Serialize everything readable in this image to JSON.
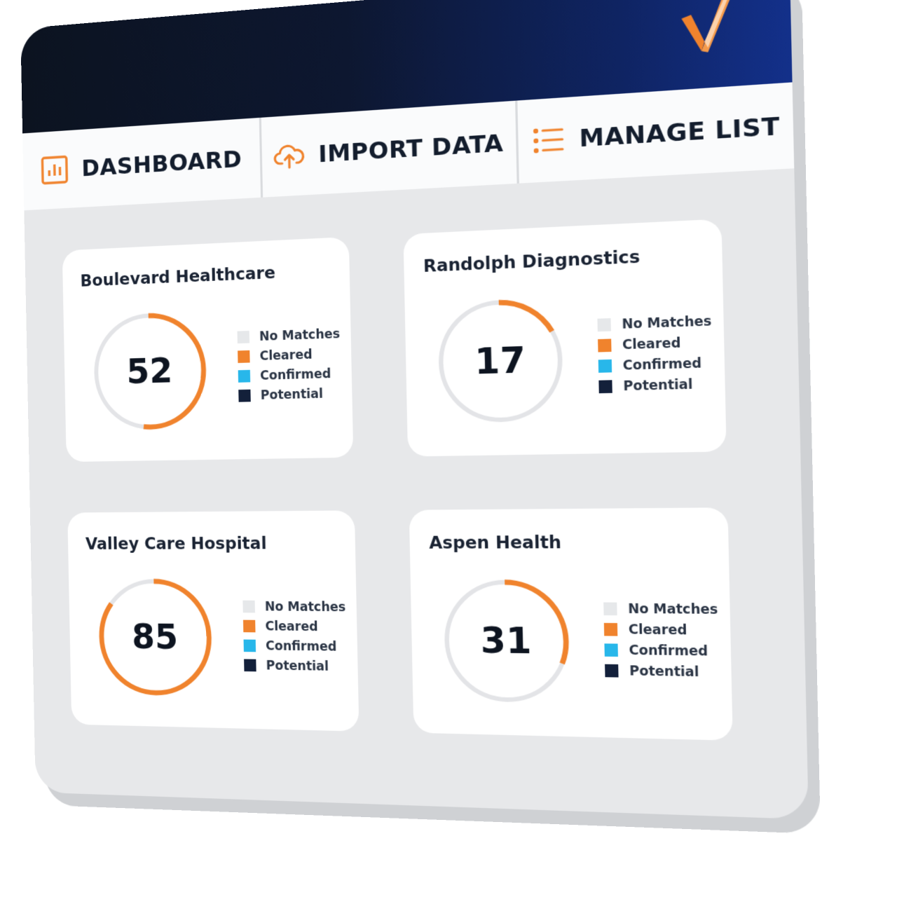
{
  "colors": {
    "accent": "#f0832d",
    "no_matches": "#e6e8ea",
    "cleared": "#f0832d",
    "confirmed": "#28b7ea",
    "potential": "#13203a",
    "ring_track": "#e3e4e7"
  },
  "nav": {
    "tabs": [
      {
        "label": "DASHBOARD",
        "icon": "bar-chart-icon"
      },
      {
        "label": "IMPORT DATA",
        "icon": "cloud-upload-icon"
      },
      {
        "label": "MANAGE LIST",
        "icon": "list-icon"
      }
    ]
  },
  "legend": [
    "No Matches",
    "Cleared",
    "Confirmed",
    "Potential"
  ],
  "cards": [
    {
      "name": "Boulevard Healthcare",
      "value": "52",
      "fraction": 0.52
    },
    {
      "name": "Randolph Diagnostics",
      "value": "17",
      "fraction": 0.17
    },
    {
      "name": "Valley Care Hospital",
      "value": "85",
      "fraction": 0.85
    },
    {
      "name": "Aspen Health",
      "value": "31",
      "fraction": 0.31
    }
  ]
}
